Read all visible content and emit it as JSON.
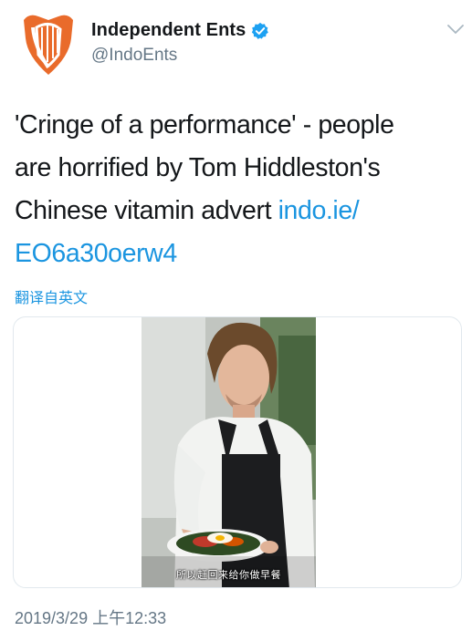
{
  "account": {
    "display_name": "Independent Ents",
    "handle": "@IndoEnts",
    "avatar_icon": "harp-logo-icon",
    "verified_icon": "verified-badge-icon",
    "brand_color": "#e96b2b",
    "verified_color": "#1da1f2"
  },
  "menu": {
    "icon": "chevron-down-icon"
  },
  "tweet": {
    "text_line1": "'Cringe of a performance' - people",
    "text_line2": "are horrified by Tom Hiddleston's",
    "text_line3_prefix": "Chinese vitamin advert ",
    "link_part1": "indo.ie/",
    "link_part2": "EO6a30oerw4",
    "link_color": "#1b95e0"
  },
  "translate_label": "翻译自英文",
  "media": {
    "type": "video",
    "subtitle": "所以赶回来给你做早餐"
  },
  "timestamp": "2019/3/29 上午12:33"
}
